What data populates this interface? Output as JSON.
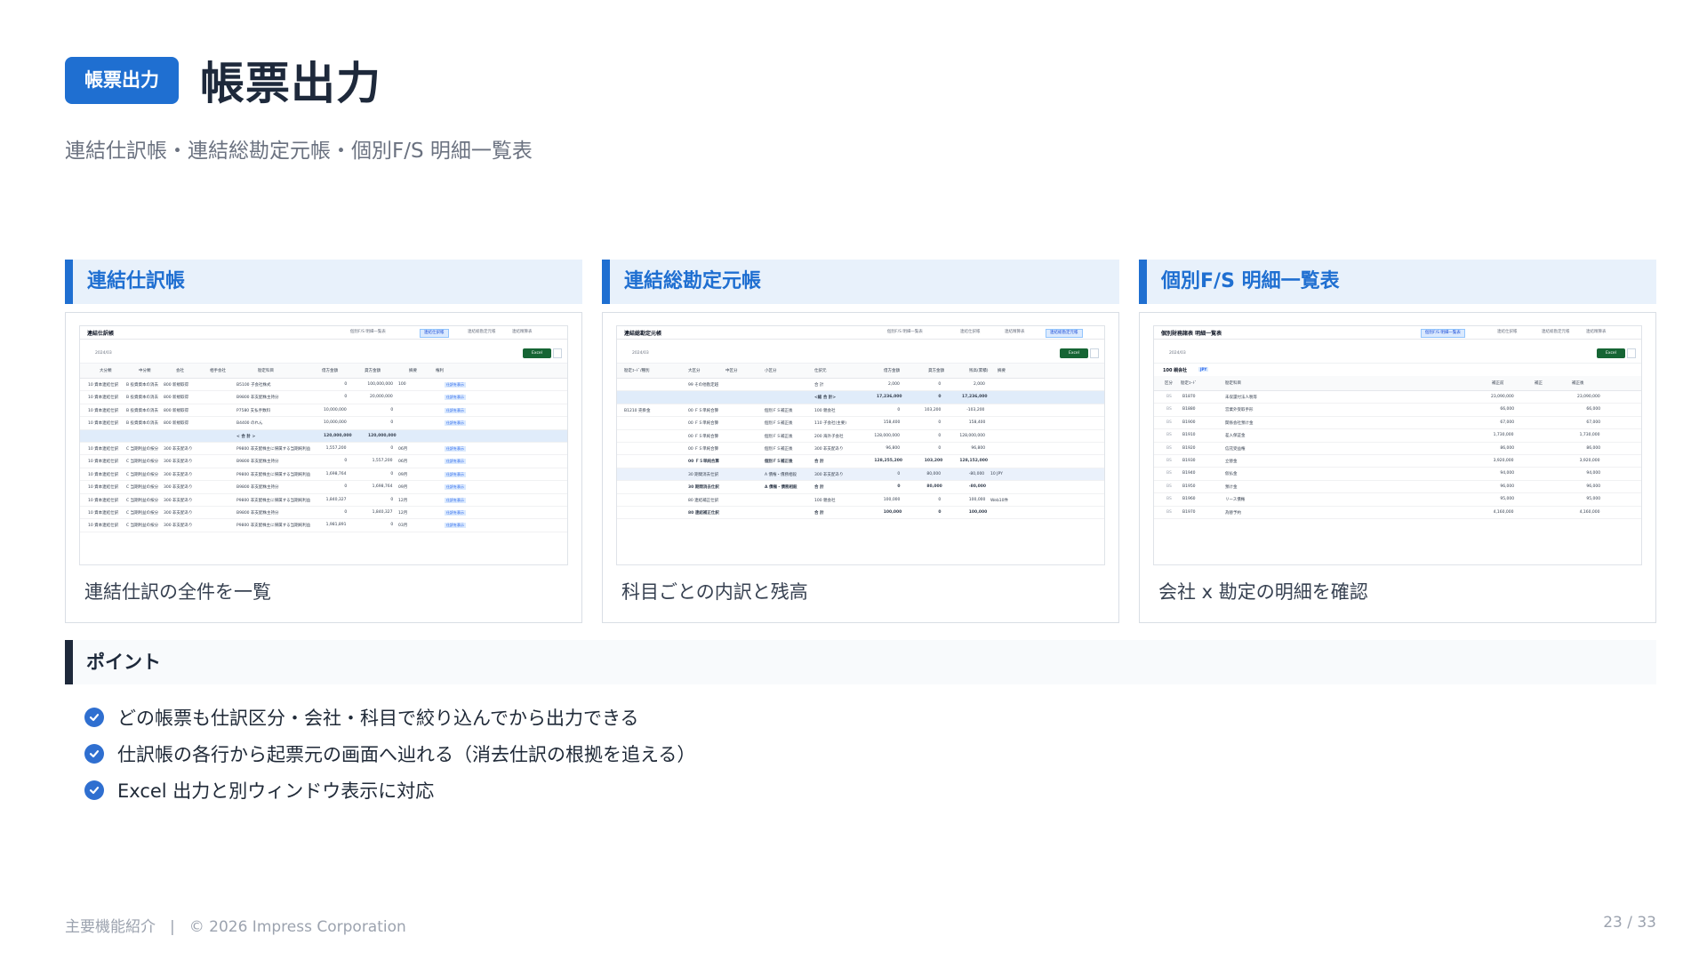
{
  "header": {
    "badge": "帳票出力",
    "title": "帳票出力"
  },
  "subtitle": "連結仕訳帳・連結総勘定元帳・個別F/S 明細一覧表",
  "cards": [
    {
      "title": "連結仕訳帳",
      "caption": "連結仕訳の全件を一覧"
    },
    {
      "title": "連結総勘定元帳",
      "caption": "科目ごとの内訳と残高"
    },
    {
      "title": "個別F/S 明細一覧表",
      "caption": "会社 x 勘定の明細を確認"
    }
  ],
  "shot1": {
    "title": "連結仕訳帳",
    "period": "2024/03",
    "tabs": [
      "個別F/S 明細一覧表",
      "連結仕訳帳",
      "連結総勘定元帳",
      "連結精算表"
    ],
    "excel": "Excel",
    "headers": [
      "大分類",
      "中分類",
      "会社",
      "相手会社",
      "勘定科目",
      "借方金額",
      "貸方金額",
      "摘要",
      "権利"
    ],
    "rows": [
      {
        "a": "10 資本連結仕訳",
        "b": "B 投資資本の消去",
        "c": "800 新規取得",
        "e": "B5100 子会社株式",
        "d": "0",
        "cr": "100,000,000",
        "m": "100"
      },
      {
        "a": "10 資本連結仕訳",
        "b": "B 投資資本の消去",
        "c": "800 新規取得",
        "e": "B9800 非支配株主持分",
        "d": "0",
        "cr": "20,000,000",
        "m": ""
      },
      {
        "a": "10 資本連結仕訳",
        "b": "B 投資資本の消去",
        "c": "800 新規取得",
        "e": "P7580 支払手数料",
        "d": "10,000,000",
        "cr": "0",
        "m": ""
      },
      {
        "a": "10 資本連結仕訳",
        "b": "B 投資資本の消去",
        "c": "800 新規取得",
        "e": "B4400 のれん",
        "d": "10,000,000",
        "cr": "0",
        "m": ""
      },
      {
        "total": true,
        "e": "< 合 計 >",
        "d": "120,000,000",
        "cr": "120,000,000"
      },
      {
        "a": "10 資本連結仕訳",
        "b": "C 当期利益の按分",
        "c": "300 非支配あり",
        "e": "P9800 非支配株主に帰属する当期純利益",
        "d": "1,557,200",
        "cr": "0",
        "m": "06月"
      },
      {
        "a": "10 資本連結仕訳",
        "b": "C 当期利益の按分",
        "c": "300 非支配あり",
        "e": "B9800 非支配株主持分",
        "d": "0",
        "cr": "1,557,200",
        "m": "06月"
      },
      {
        "a": "10 資本連結仕訳",
        "b": "C 当期利益の按分",
        "c": "300 非支配あり",
        "e": "P9800 非支配株主に帰属する当期純利益",
        "d": "1,698,764",
        "cr": "0",
        "m": "09月"
      },
      {
        "a": "10 資本連結仕訳",
        "b": "C 当期利益の按分",
        "c": "300 非支配あり",
        "e": "B9800 非支配株主持分",
        "d": "0",
        "cr": "1,698,764",
        "m": "09月"
      },
      {
        "a": "10 資本連結仕訳",
        "b": "C 当期利益の按分",
        "c": "300 非支配あり",
        "e": "P9800 非支配株主に帰属する当期純利益",
        "d": "1,840,327",
        "cr": "0",
        "m": "12月"
      },
      {
        "a": "10 資本連結仕訳",
        "b": "C 当期利益の按分",
        "c": "300 非支配あり",
        "e": "B9800 非支配株主持分",
        "d": "0",
        "cr": "1,840,327",
        "m": "12月"
      },
      {
        "a": "10 資本連結仕訳",
        "b": "C 当期利益の按分",
        "c": "300 非支配あり",
        "e": "P9800 非支配株主に帰属する当期純利益",
        "d": "1,981,891",
        "cr": "0",
        "m": "03月"
      }
    ],
    "badge": "仕訳を表示"
  },
  "shot2": {
    "title": "連結総勘定元帳",
    "period": "2024/03",
    "tabs": [
      "個別F/S 明細一覧表",
      "連結仕訳帳",
      "連結精算表",
      "連結総勘定元帳"
    ],
    "excel": "Excel",
    "headers": [
      "勘定ｺｰﾄﾞ/種別",
      "大区分",
      "中区分",
      "小区分",
      "仕訳元",
      "借方金額",
      "貸方金額",
      "残高(累積)",
      "摘要"
    ],
    "rows": [
      {
        "a": "",
        "b": "99 その他勘定越",
        "e": "合 計",
        "d": "2,000",
        "cr": "0",
        "bal": "2,000"
      },
      {
        "total": true,
        "e": "<総 合 計>",
        "d": "17,236,000",
        "cr": "0",
        "bal": "17,236,000"
      },
      {
        "a": "B1210 売掛金",
        "b": "00 ＦＳ単純合算",
        "c": "個別ＦＳ補正後",
        "e": "100 親会社",
        "d": "0",
        "cr": "103,200",
        "bal": "-103,200"
      },
      {
        "b": "00 ＦＳ単純合算",
        "c": "個別ＦＳ補正後",
        "e": "110 子会社(主要)",
        "d": "158,400",
        "cr": "0",
        "bal": "158,400"
      },
      {
        "b": "00 ＦＳ単純合算",
        "c": "個別ＦＳ補正後",
        "e": "200 海外子会社",
        "d": "128,000,000",
        "cr": "0",
        "bal": "128,000,000"
      },
      {
        "b": "00 ＦＳ単純合算",
        "c": "個別ＦＳ補正後",
        "e": "300 非支配あり",
        "d": "96,800",
        "cr": "0",
        "bal": "96,800"
      },
      {
        "b": "00 ＦＳ単純合算",
        "c": "個別ＦＳ補正後",
        "e": "合 計",
        "d": "128,255,200",
        "cr": "103,200",
        "bal": "128,152,000",
        "bold": true
      },
      {
        "hl": true,
        "b": "30 期間消去仕訳",
        "c": "A 債権・債務相殺",
        "e": "300 非支配あり",
        "d": "0",
        "cr": "80,000",
        "bal": "-80,000",
        "m": "10 JPY"
      },
      {
        "b": "30 期間消去仕訳",
        "c": "A 債権・債務相殺",
        "e": "合 計",
        "d": "0",
        "cr": "80,000",
        "bal": "-80,000",
        "bold": true
      },
      {
        "b": "80 連結補正仕訳",
        "e": "100 親会社",
        "d": "100,000",
        "cr": "0",
        "bal": "100,000",
        "m": "Web10件"
      },
      {
        "b": "80 連結補正仕訳",
        "e": "合 計",
        "d": "100,000",
        "cr": "0",
        "bal": "100,000",
        "bold": true
      }
    ]
  },
  "shot3": {
    "title": "個別財務諸表 明細一覧表",
    "period": "2024/03",
    "tabs": [
      "個別F/S 明細一覧表",
      "連結仕訳帳",
      "連結総勘定元帳",
      "連結精算表"
    ],
    "excel": "Excel",
    "group": "100 親会社",
    "currency": "JPY",
    "headers": [
      "区分",
      "勘定ｺｰﾄﾞ",
      "勘定科目",
      "補正前",
      "補正",
      "補正後"
    ],
    "rows": [
      {
        "k": "BS",
        "c": "B1870",
        "n": "未収還付法人税等",
        "v": "23,090,000",
        "v2": "23,090,000"
      },
      {
        "k": "BS",
        "c": "B1880",
        "n": "営業外受取手形",
        "v": "66,000",
        "v2": "66,000"
      },
      {
        "k": "BS",
        "c": "B1900",
        "n": "関係会社預け金",
        "v": "67,000",
        "v2": "67,000"
      },
      {
        "k": "BS",
        "c": "B1910",
        "n": "差入保証金",
        "v": "1,730,000",
        "v2": "1,730,000"
      },
      {
        "k": "BS",
        "c": "B1920",
        "n": "信託受益権",
        "v": "86,000",
        "v2": "86,000"
      },
      {
        "k": "BS",
        "c": "B1930",
        "n": "立替金",
        "v": "3,920,000",
        "v2": "3,920,000"
      },
      {
        "k": "BS",
        "c": "B1940",
        "n": "仮払金",
        "v": "94,000",
        "v2": "94,000"
      },
      {
        "k": "BS",
        "c": "B1950",
        "n": "預け金",
        "v": "96,000",
        "v2": "96,000"
      },
      {
        "k": "BS",
        "c": "B1960",
        "n": "リース債権",
        "v": "95,000",
        "v2": "95,000"
      },
      {
        "k": "BS",
        "c": "B1970",
        "n": "為替予約",
        "v": "4,160,000",
        "v2": "4,160,000"
      }
    ]
  },
  "points": {
    "heading": "ポイント",
    "items": [
      "どの帳票も仕訳区分・会社・科目で絞り込んでから出力できる",
      "仕訳帳の各行から起票元の画面へ辿れる（消去仕訳の根拠を追える）",
      "Excel 出力と別ウィンドウ表示に対応"
    ]
  },
  "footer": {
    "section": "主要機能紹介",
    "sep": "|",
    "copyright": "© 2026 Impress Corporation",
    "page": "23 / 33"
  }
}
